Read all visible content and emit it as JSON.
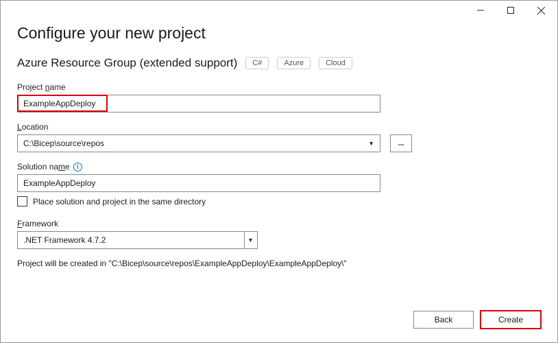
{
  "titlebar": {
    "minimize_icon": "minimize",
    "maximize_icon": "maximize",
    "close_icon": "close"
  },
  "header": {
    "title": "Configure your new project",
    "subtitle": "Azure Resource Group (extended support)",
    "tags": [
      "C#",
      "Azure",
      "Cloud"
    ]
  },
  "fields": {
    "project_name": {
      "label_pre": "Project ",
      "label_u": "n",
      "label_post": "ame",
      "value": "ExampleAppDeploy"
    },
    "location": {
      "label_u": "L",
      "label_post": "ocation",
      "value": "C:\\Bicep\\source\\repos",
      "browse": "..."
    },
    "solution_name": {
      "label_pre": "Solution na",
      "label_u": "m",
      "label_post": "e",
      "info": "i",
      "value": "ExampleAppDeploy"
    },
    "same_dir": {
      "label_pre": "Place solution and project in the same ",
      "label_u": "d",
      "label_post": "irectory"
    },
    "framework": {
      "label_u": "F",
      "label_post": "ramework",
      "value": ".NET Framework 4.7.2"
    }
  },
  "hint": "Project will be created in \"C:\\Bicep\\source\\repos\\ExampleAppDeploy\\ExampleAppDeploy\\\"",
  "buttons": {
    "back_u": "B",
    "back_post": "ack",
    "create": "Create"
  }
}
